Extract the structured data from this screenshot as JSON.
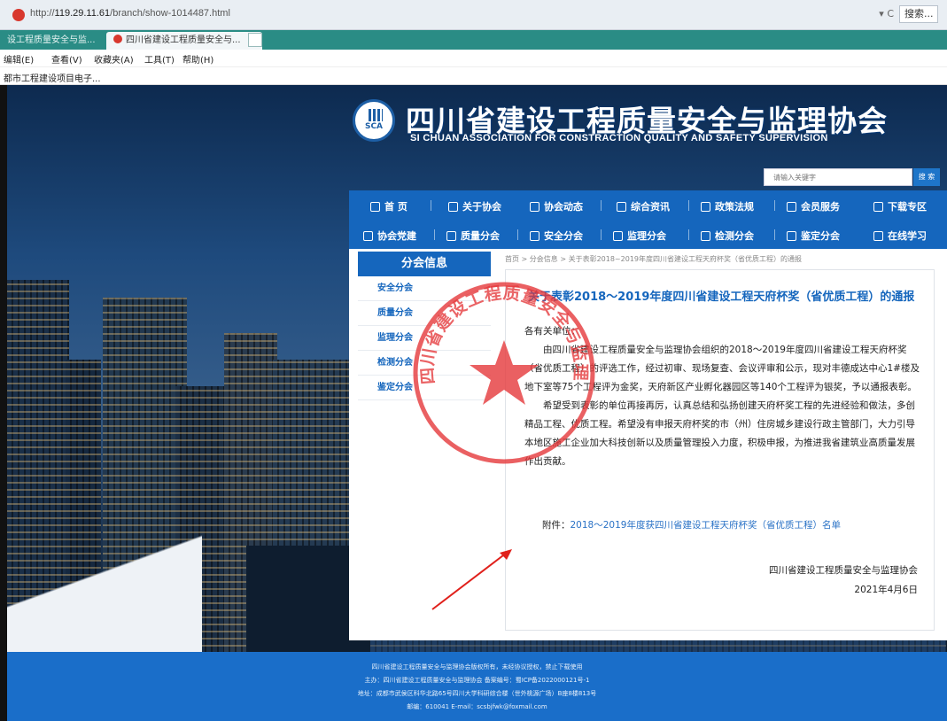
{
  "browser": {
    "url_prefix": "http://",
    "url_host": "119.29.11.61",
    "url_path": "/branch/show-1014487.html",
    "refresh_label": "▾ C",
    "search_label": "搜索..."
  },
  "tabs": [
    {
      "label": "设工程质量安全与监..."
    },
    {
      "label": "四川省建设工程质量安全与...",
      "close": "×"
    }
  ],
  "menu": [
    "编辑(E)",
    "查看(V)",
    "收藏夹(A)",
    "工具(T)",
    "帮助(H)"
  ],
  "favorites": [
    "都市工程建设项目电子..."
  ],
  "site": {
    "logo_text": "SCA",
    "title": "四川省建设工程质量安全与监理协会",
    "subtitle": "SI CHUAN ASSOCIATION FOR CONSTRACTION QUALITY AND SAFETY SUPERVISION",
    "search_placeholder": "请输入关键字",
    "search_button": "搜 索"
  },
  "nav_row1": [
    "首 页",
    "关于协会",
    "协会动态",
    "综合资讯",
    "政策法规",
    "会员服务",
    "下载专区"
  ],
  "nav_row2": [
    "协会党建",
    "质量分会",
    "安全分会",
    "监理分会",
    "检测分会",
    "鉴定分会",
    "在线学习"
  ],
  "sidebar": {
    "title": "分会信息",
    "items": [
      "安全分会",
      "质量分会",
      "监理分会",
      "检测分会",
      "鉴定分会"
    ]
  },
  "breadcrumb": "首页 > 分会信息 > 关于表彰2018~2019年度四川省建设工程天府杯奖（省优质工程）的通报",
  "article": {
    "title": "关于表彰2018～2019年度四川省建设工程天府杯奖（省优质工程）的通报",
    "salutation": "各有关单位：",
    "para1": "由四川省建设工程质量安全与监理协会组织的2018～2019年度四川省建设工程天府杯奖（省优质工程）的评选工作，经过初审、现场复查、会议评审和公示，现对丰德成达中心1#楼及地下室等75个工程评为金奖，天府新区产业孵化器园区等140个工程评为银奖，予以通报表彰。",
    "para2": "希望受到表彰的单位再接再厉，认真总结和弘扬创建天府杯奖工程的先进经验和做法，多创精品工程、优质工程。希望没有申报天府杯奖的市（州）住房城乡建设行政主管部门，大力引导本地区施工企业加大科技创新以及质量管理投入力度，积极申报，为推进我省建筑业高质量发展作出贡献。",
    "attachment_label": "附件：",
    "attachment_link": "2018～2019年度获四川省建设工程天府杯奖（省优质工程）名单",
    "signature_org": "四川省建设工程质量安全与监理协会",
    "signature_date": "2021年4月6日"
  },
  "stamp": {
    "text": "四川省建设工程质量安全与监理协会",
    "code": "5101040"
  },
  "footer": [
    "四川省建设工程质量安全与监理协会版权所有，未经协议授权，禁止下载使用",
    "主办：四川省建设工程质量安全与监理协会  备案编号：蜀ICP备2022000121号-1",
    "地址：成都市武侯区科华北路65号四川大学科研综合楼（世外桃源广场）B座8楼813号",
    "邮编：610041  E-mail：scsbjfwk@foxmail.com"
  ],
  "colors": {
    "accent": "#1566bd",
    "footer": "#1a6ec9",
    "tab_bar": "#2a8c85",
    "stamp": "#e5383b"
  }
}
